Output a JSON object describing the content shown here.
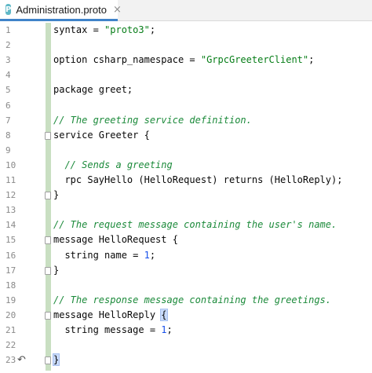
{
  "tab": {
    "icon_letter": "P",
    "title": "Administration.proto",
    "close": "×"
  },
  "gutter_icons": {
    "undo_icon": "↶"
  },
  "lines": [
    {
      "n": "1",
      "parts": [
        {
          "t": "syntax = ",
          "c": ""
        },
        {
          "t": "\"proto3\"",
          "c": "str"
        },
        {
          "t": ";",
          "c": ""
        }
      ]
    },
    {
      "n": "2",
      "parts": []
    },
    {
      "n": "3",
      "parts": [
        {
          "t": "option csharp_namespace = ",
          "c": ""
        },
        {
          "t": "\"GrpcGreeterClient\"",
          "c": "str"
        },
        {
          "t": ";",
          "c": ""
        }
      ]
    },
    {
      "n": "4",
      "parts": []
    },
    {
      "n": "5",
      "parts": [
        {
          "t": "package greet;",
          "c": ""
        }
      ]
    },
    {
      "n": "6",
      "parts": []
    },
    {
      "n": "7",
      "parts": [
        {
          "t": "// The greeting service definition.",
          "c": "cmt"
        }
      ]
    },
    {
      "n": "8",
      "parts": [
        {
          "t": "service Greeter {",
          "c": ""
        }
      ]
    },
    {
      "n": "9",
      "parts": []
    },
    {
      "n": "10",
      "parts": [
        {
          "t": "  // Sends a greeting",
          "c": "cmt"
        }
      ]
    },
    {
      "n": "11",
      "parts": [
        {
          "t": "  rpc SayHello (HelloRequest) returns (HelloReply);",
          "c": ""
        }
      ]
    },
    {
      "n": "12",
      "parts": [
        {
          "t": "}",
          "c": ""
        }
      ]
    },
    {
      "n": "13",
      "parts": []
    },
    {
      "n": "14",
      "parts": [
        {
          "t": "// The request message containing the user's name.",
          "c": "cmt"
        }
      ]
    },
    {
      "n": "15",
      "parts": [
        {
          "t": "message HelloRequest {",
          "c": ""
        }
      ]
    },
    {
      "n": "16",
      "parts": [
        {
          "t": "  string name = ",
          "c": ""
        },
        {
          "t": "1",
          "c": "num"
        },
        {
          "t": ";",
          "c": ""
        }
      ]
    },
    {
      "n": "17",
      "parts": [
        {
          "t": "}",
          "c": ""
        }
      ]
    },
    {
      "n": "18",
      "parts": []
    },
    {
      "n": "19",
      "parts": [
        {
          "t": "// The response message containing the greetings.",
          "c": "cmt"
        }
      ]
    },
    {
      "n": "20",
      "parts": [
        {
          "t": "message HelloReply ",
          "c": ""
        },
        {
          "t": "{",
          "c": "brace"
        }
      ]
    },
    {
      "n": "21",
      "parts": [
        {
          "t": "  string message = ",
          "c": ""
        },
        {
          "t": "1",
          "c": "num"
        },
        {
          "t": ";",
          "c": ""
        }
      ]
    },
    {
      "n": "22",
      "parts": []
    },
    {
      "n": "23",
      "parts": [
        {
          "t": "}",
          "c": "brace"
        }
      ]
    }
  ]
}
